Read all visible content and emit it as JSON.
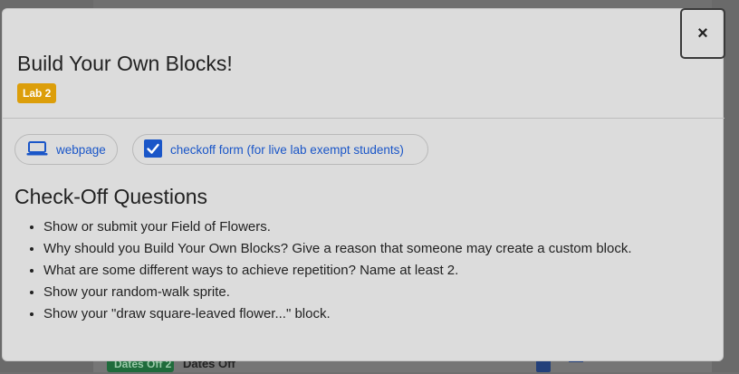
{
  "background": {
    "badge_label": "Dates Off 2",
    "row_label": "Dates Off"
  },
  "modal": {
    "title": "Build Your Own Blocks!",
    "badge": "Lab 2",
    "close_label": "×",
    "resources": [
      {
        "label": "webpage",
        "icon": "laptop-icon"
      },
      {
        "label": "checkoff form (for live lab exempt students)",
        "icon": "checkbox-icon"
      }
    ],
    "section_title": "Check-Off Questions",
    "questions": [
      "Show or submit your Field of Flowers.",
      "Why should you Build Your Own Blocks? Give a reason that someone may create a custom block.",
      "What are some different ways to achieve repetition? Name at least 2.",
      "Show your random-walk sprite.",
      "Show your \"draw square-leaved flower...\" block."
    ]
  },
  "colors": {
    "badge_background": "#dc9e0a",
    "link": "#1a56c8",
    "modal_background": "#dcdcdc"
  }
}
